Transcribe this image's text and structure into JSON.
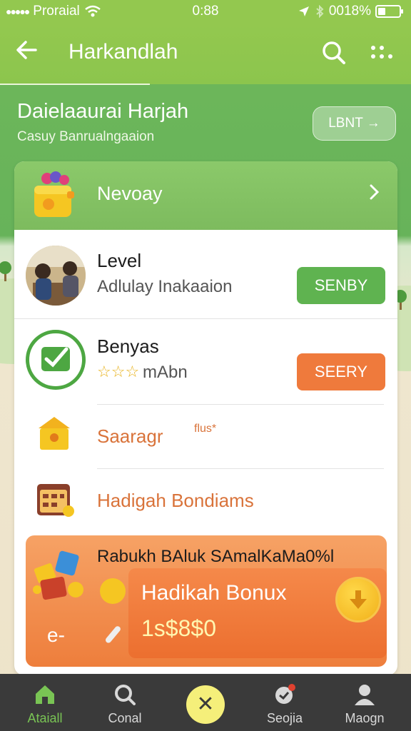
{
  "status_bar": {
    "carrier": "Proraial",
    "time": "0:88",
    "battery_text": "0018%"
  },
  "header": {
    "title": "Harkandlah"
  },
  "hero": {
    "title": "Daielaaurai Harjah",
    "subtitle": "Casuy Banrualngaaion",
    "button_label": "LBNT →"
  },
  "promo": {
    "label": "Nevoay"
  },
  "items": [
    {
      "title": "Level",
      "subtitle": "Adlulay Inakaaion",
      "button": "SENBY"
    },
    {
      "title": "Benyas",
      "stars": "☆☆☆",
      "subtitle": "mAbn",
      "button": "SEERY"
    },
    {
      "title": "Saaragr",
      "tag": "flus*"
    },
    {
      "title": "Hadigah Bondiams"
    }
  ],
  "bonus": {
    "headline": "Rabukh BAluk SAmalKaMa0%l",
    "title": "Hadikah Bonux",
    "amount": "1s$8$0",
    "side_text": "e-"
  },
  "bottom_nav": [
    {
      "label": "Ataiall",
      "icon": "home-icon",
      "active": true
    },
    {
      "label": "Conal",
      "icon": "search-icon",
      "active": false
    },
    {
      "label": "",
      "icon": "close-icon",
      "active": false
    },
    {
      "label": "Seojia",
      "icon": "message-icon",
      "active": false
    },
    {
      "label": "Maogn",
      "icon": "user-icon",
      "active": false
    }
  ],
  "colors": {
    "header_green": "#93c84f",
    "accent_green": "#5fb350",
    "accent_orange": "#ef7a3c",
    "nav_dark": "#3a3a3a"
  }
}
